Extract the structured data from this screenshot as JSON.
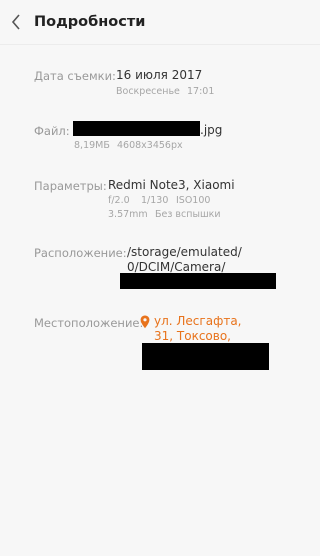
{
  "header": {
    "title": "Подробности",
    "back_icon": "chevron-left-icon"
  },
  "details": {
    "date": {
      "label": "Дата съемки:",
      "value": "16 июля 2017",
      "weekday": "Воскресенье",
      "time": "17:01"
    },
    "file": {
      "label": "Файл:",
      "extension": ".jpg",
      "size": "8,19МБ",
      "resolution": "4608x3456px"
    },
    "params": {
      "label": "Параметры:",
      "device": "Redmi Note3, Xiaomi",
      "aperture": "f/2.0",
      "shutter": "1/130",
      "iso": "ISO100",
      "focal": "3.57mm",
      "flash": "Без вспышки"
    },
    "path": {
      "label": "Расположение:",
      "line1": "/storage/emulated/",
      "line2": "0/DCIM/Camera/"
    },
    "location": {
      "label": "Местоположение:",
      "line1": "ул. Лесгафта,",
      "line2": "31, Токсово,",
      "icon": "location-pin-icon",
      "color": "#e8731c"
    }
  }
}
